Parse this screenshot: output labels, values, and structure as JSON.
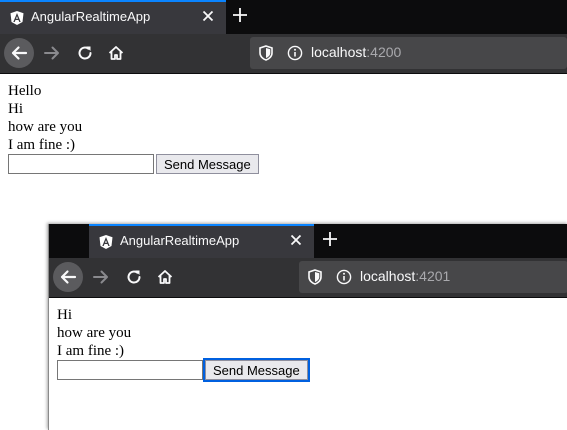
{
  "windows": [
    {
      "tab": {
        "title": "AngularRealtimeApp"
      },
      "url": {
        "host": "localhost",
        "port": ":4200"
      },
      "messages": [
        "Hello",
        "Hi",
        "how are you",
        "I am fine :)"
      ],
      "input": {
        "value": "",
        "placeholder": ""
      },
      "send_label": "Send Message"
    },
    {
      "tab": {
        "title": "AngularRealtimeApp"
      },
      "url": {
        "host": "localhost",
        "port": ":4201"
      },
      "messages": [
        "Hi",
        "how are you",
        "I am fine :)"
      ],
      "input": {
        "value": "",
        "placeholder": ""
      },
      "send_label": "Send Message"
    }
  ],
  "icons": {
    "tab_logo": "angular-logo-icon",
    "close": "close-icon",
    "new_tab": "plus-icon",
    "back": "back-arrow-icon",
    "forward": "forward-arrow-icon",
    "reload": "reload-icon",
    "home": "home-icon",
    "shield": "shield-icon",
    "info": "info-icon"
  },
  "colors": {
    "tab_accent": "#0a84ff",
    "tabbar_bg": "#0c0c0d",
    "toolbar_bg": "#323234",
    "urlbar_bg": "#474749"
  }
}
